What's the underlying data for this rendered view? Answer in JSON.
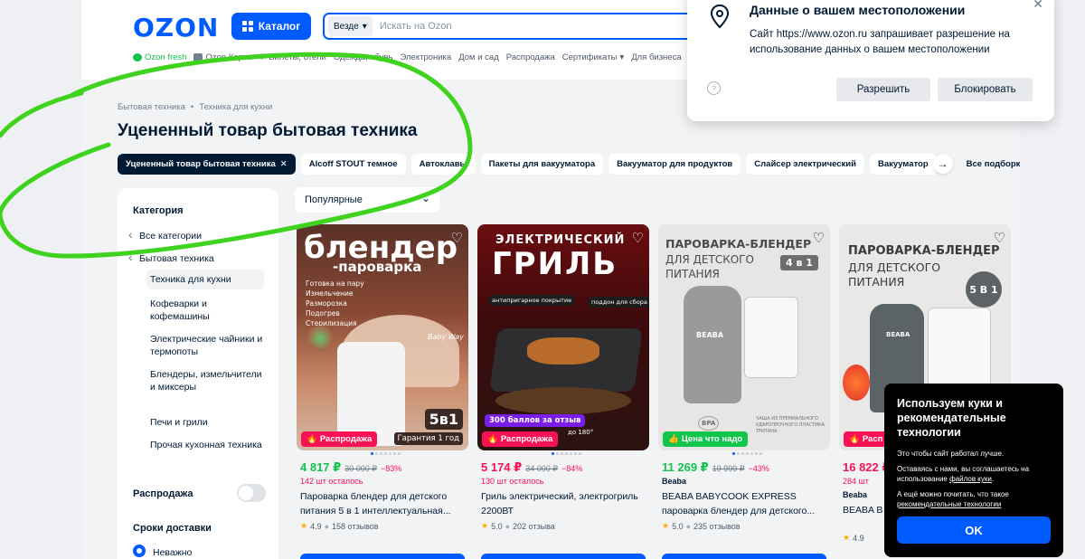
{
  "header": {
    "logo": "OZON",
    "catalog_label": "Каталог",
    "search_scope": "Везде",
    "search_placeholder": "Искать на Ozon",
    "quick_links": [
      "Ozon fresh",
      "Ozon Карта",
      "Билеты, отели",
      "Одежда, обувь",
      "Электроника",
      "Дом и сад",
      "Распродажа",
      "Сертификаты",
      "Для бизнеса"
    ]
  },
  "breadcrumb": [
    "Бытовая техника",
    "Техника для кухни"
  ],
  "page_title": "Уцененный товар бытовая техника",
  "chips": [
    "Уцененный товар бытовая техника",
    "Alcoff STOUT темное",
    "Автоклавы",
    "Пакеты для вакууматора",
    "Вакууматор для продуктов",
    "Слайсер электрический",
    "Вакууматор",
    "Все подборки"
  ],
  "sidebar": {
    "category_title": "Категория",
    "items": [
      "Все категории",
      "Бытовая техника",
      "Техника для кухни",
      "Кофеварки и кофемашины",
      "Электрические чайники и термопоты",
      "Блендеры, измельчители и миксеры",
      "Печи и грили",
      "Прочая кухонная техника"
    ],
    "sale_label": "Распродажа",
    "delivery_label": "Сроки доставки",
    "delivery_option": "Неважно"
  },
  "sort": {
    "selected": "Популярные"
  },
  "products": [
    {
      "img_title": "блендер",
      "img_subtitle": "-пароварка",
      "img_bullets": [
        "Готовка на пару",
        "Измельчение",
        "Разморозка",
        "Подогрев",
        "Стерилизация"
      ],
      "img_count": "5в1",
      "img_warranty": "Гарантия 1 год",
      "img_brand": "Baby Way",
      "badge": "Распродажа",
      "price": "4 817 ₽",
      "old_price": "30 000 ₽",
      "discount": "−83%",
      "stock": "142 шт осталось",
      "brand": "",
      "name": "Пароварка блендер для детского питания 5 в 1 интеллектуальная...",
      "rating": "4.9",
      "reviews": "158 отзывов"
    },
    {
      "img_title_1": "ЭЛЕКТРИЧЕСКИЙ",
      "img_title_2": "ГРИЛЬ",
      "img_note_1": "антипригарное покрытие",
      "img_note_2": "поддон для сбора жира",
      "img_promo": "300 баллов за отзыв",
      "img_temp": "до 180°",
      "badge": "Распродажа",
      "price": "5 174 ₽",
      "old_price": "34 000 ₽",
      "discount": "−84%",
      "stock": "130 шт осталось",
      "brand": "",
      "name": "Гриль электрический, электрогриль 2200ВТ",
      "rating": "5.0",
      "reviews": "202 отзыва"
    },
    {
      "img_title_1": "ПАРОВАРКА-БЛЕНДЕР",
      "img_title_2": "ДЛЯ ДЕТСКОГО",
      "img_title_3": "ПИТАНИЯ",
      "img_count": "4 в 1",
      "img_brand": "BEABA",
      "img_note": "ЧАША ИЗ ПРЕМИАЛЬНОГО УДАРОПРОЧНОГО ПЛАСТИКА ТРИТАНА",
      "img_bpa": "BPA",
      "badge": "Цена что надо",
      "price": "11 269 ₽",
      "old_price": "19 999 ₽",
      "discount": "−43%",
      "stock": "",
      "brand": "Beaba",
      "name": "BEABA BABYCOOK EXPRESS пароварка блендер для детского...",
      "rating": "5.0",
      "reviews": "235 отзывов"
    },
    {
      "img_title_1": "ПАРОВАРКА-БЛЕНДЕР",
      "img_title_2": "ДЛЯ ДЕТСКОГО",
      "img_title_3": "ПИТАНИЯ",
      "img_count": "5 В 1",
      "img_brand": "BEABA",
      "badge": "Расп",
      "price": "16 822 ₽",
      "old_price": "",
      "discount": "",
      "stock": "284 шт",
      "brand": "Beaba",
      "name": "BEABA B",
      "rating": "4.9",
      "reviews": ""
    }
  ],
  "location_popup": {
    "title": "Данные о вашем местоположении",
    "text": "Сайт https://www.ozon.ru запрашивает разрешение на использование данных о вашем местоположении",
    "allow": "Разрешить",
    "block": "Блокировать",
    "help_icon": "?"
  },
  "cookie_banner": {
    "title": "Используем куки и рекомендательные технологии",
    "line1": "Это чтобы сайт работал лучше.",
    "line2_pre": "Оставаясь с нами, вы соглашаетесь на использование ",
    "line2_link": "файлов куки",
    "line2_post": ".",
    "line3_pre": "А ещё можно почитать, что такое ",
    "line3_link": "рекомендательные технологии",
    "ok": "OK"
  },
  "colors": {
    "brand_blue": "#005bff",
    "sale_pink": "#f91155",
    "dark": "#001a34",
    "annotation_green": "#3fd31f",
    "good_price_green": "#10c44c"
  }
}
